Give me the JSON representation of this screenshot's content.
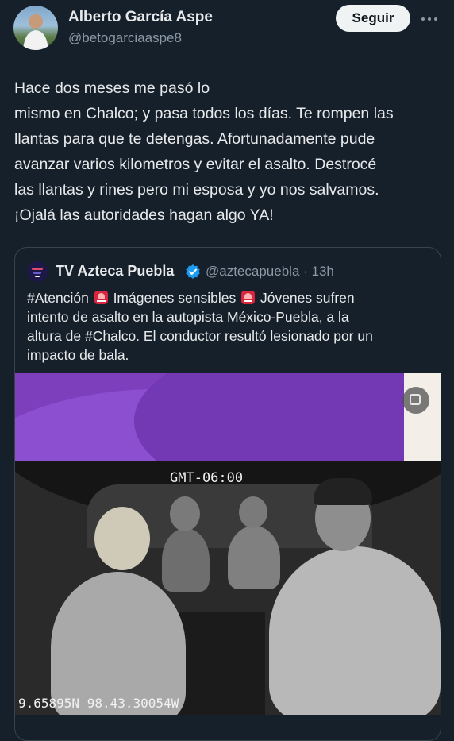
{
  "author": {
    "name": "Alberto García Aspe",
    "handle": "@betogarciaaspe8",
    "follow_label": "Seguir"
  },
  "tweet": {
    "lines": [
      "Hace dos meses me pasó lo",
      "mismo en Chalco; y pasa todos los días. Te rompen las",
      "llantas para que te detengas. Afortunadamente pude",
      "avanzar varios kilometros y evitar el asalto. Destrocé",
      "las llantas y rines pero mi esposa y yo nos salvamos.",
      "¡Ojalá las autoridades hagan algo YA!"
    ]
  },
  "quote": {
    "name": "TV Azteca Puebla",
    "handle_time": "@aztecapuebla · 13h",
    "line1": {
      "a": "#Atención ",
      "b": " Imágenes sensibles ",
      "c": " Jóvenes sufren"
    },
    "lines": [
      "intento de asalto en la autopista México-Puebla, a la",
      "altura de #Chalco. El conductor resultó lesionado por un",
      "impacto de bala."
    ],
    "media": {
      "timestamp_overlay": "GMT-06:00",
      "coords_overlay": "9.65895N 98.43.30054W"
    }
  },
  "icons": {
    "more": "more-dots-icon",
    "verified": "verified-badge-icon",
    "siren": "police-light-icon",
    "media": "media-settings-icon"
  },
  "colors": {
    "background": "#15202b",
    "verified": "#1d9bf0",
    "follow_bg": "#eff3f4"
  }
}
